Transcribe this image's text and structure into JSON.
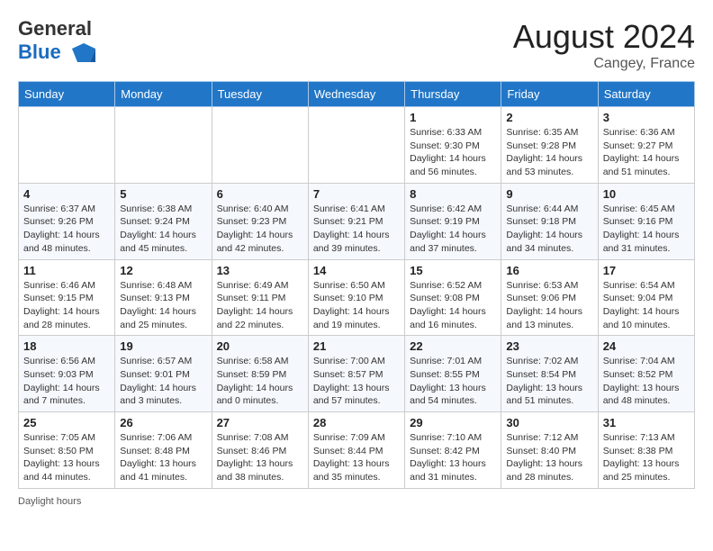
{
  "header": {
    "logo_line1": "General",
    "logo_line2": "Blue",
    "month": "August 2024",
    "location": "Cangey, France"
  },
  "days_of_week": [
    "Sunday",
    "Monday",
    "Tuesday",
    "Wednesday",
    "Thursday",
    "Friday",
    "Saturday"
  ],
  "weeks": [
    [
      {
        "day": "",
        "info": ""
      },
      {
        "day": "",
        "info": ""
      },
      {
        "day": "",
        "info": ""
      },
      {
        "day": "",
        "info": ""
      },
      {
        "day": "1",
        "info": "Sunrise: 6:33 AM\nSunset: 9:30 PM\nDaylight: 14 hours and 56 minutes."
      },
      {
        "day": "2",
        "info": "Sunrise: 6:35 AM\nSunset: 9:28 PM\nDaylight: 14 hours and 53 minutes."
      },
      {
        "day": "3",
        "info": "Sunrise: 6:36 AM\nSunset: 9:27 PM\nDaylight: 14 hours and 51 minutes."
      }
    ],
    [
      {
        "day": "4",
        "info": "Sunrise: 6:37 AM\nSunset: 9:26 PM\nDaylight: 14 hours and 48 minutes."
      },
      {
        "day": "5",
        "info": "Sunrise: 6:38 AM\nSunset: 9:24 PM\nDaylight: 14 hours and 45 minutes."
      },
      {
        "day": "6",
        "info": "Sunrise: 6:40 AM\nSunset: 9:23 PM\nDaylight: 14 hours and 42 minutes."
      },
      {
        "day": "7",
        "info": "Sunrise: 6:41 AM\nSunset: 9:21 PM\nDaylight: 14 hours and 39 minutes."
      },
      {
        "day": "8",
        "info": "Sunrise: 6:42 AM\nSunset: 9:19 PM\nDaylight: 14 hours and 37 minutes."
      },
      {
        "day": "9",
        "info": "Sunrise: 6:44 AM\nSunset: 9:18 PM\nDaylight: 14 hours and 34 minutes."
      },
      {
        "day": "10",
        "info": "Sunrise: 6:45 AM\nSunset: 9:16 PM\nDaylight: 14 hours and 31 minutes."
      }
    ],
    [
      {
        "day": "11",
        "info": "Sunrise: 6:46 AM\nSunset: 9:15 PM\nDaylight: 14 hours and 28 minutes."
      },
      {
        "day": "12",
        "info": "Sunrise: 6:48 AM\nSunset: 9:13 PM\nDaylight: 14 hours and 25 minutes."
      },
      {
        "day": "13",
        "info": "Sunrise: 6:49 AM\nSunset: 9:11 PM\nDaylight: 14 hours and 22 minutes."
      },
      {
        "day": "14",
        "info": "Sunrise: 6:50 AM\nSunset: 9:10 PM\nDaylight: 14 hours and 19 minutes."
      },
      {
        "day": "15",
        "info": "Sunrise: 6:52 AM\nSunset: 9:08 PM\nDaylight: 14 hours and 16 minutes."
      },
      {
        "day": "16",
        "info": "Sunrise: 6:53 AM\nSunset: 9:06 PM\nDaylight: 14 hours and 13 minutes."
      },
      {
        "day": "17",
        "info": "Sunrise: 6:54 AM\nSunset: 9:04 PM\nDaylight: 14 hours and 10 minutes."
      }
    ],
    [
      {
        "day": "18",
        "info": "Sunrise: 6:56 AM\nSunset: 9:03 PM\nDaylight: 14 hours and 7 minutes."
      },
      {
        "day": "19",
        "info": "Sunrise: 6:57 AM\nSunset: 9:01 PM\nDaylight: 14 hours and 3 minutes."
      },
      {
        "day": "20",
        "info": "Sunrise: 6:58 AM\nSunset: 8:59 PM\nDaylight: 14 hours and 0 minutes."
      },
      {
        "day": "21",
        "info": "Sunrise: 7:00 AM\nSunset: 8:57 PM\nDaylight: 13 hours and 57 minutes."
      },
      {
        "day": "22",
        "info": "Sunrise: 7:01 AM\nSunset: 8:55 PM\nDaylight: 13 hours and 54 minutes."
      },
      {
        "day": "23",
        "info": "Sunrise: 7:02 AM\nSunset: 8:54 PM\nDaylight: 13 hours and 51 minutes."
      },
      {
        "day": "24",
        "info": "Sunrise: 7:04 AM\nSunset: 8:52 PM\nDaylight: 13 hours and 48 minutes."
      }
    ],
    [
      {
        "day": "25",
        "info": "Sunrise: 7:05 AM\nSunset: 8:50 PM\nDaylight: 13 hours and 44 minutes."
      },
      {
        "day": "26",
        "info": "Sunrise: 7:06 AM\nSunset: 8:48 PM\nDaylight: 13 hours and 41 minutes."
      },
      {
        "day": "27",
        "info": "Sunrise: 7:08 AM\nSunset: 8:46 PM\nDaylight: 13 hours and 38 minutes."
      },
      {
        "day": "28",
        "info": "Sunrise: 7:09 AM\nSunset: 8:44 PM\nDaylight: 13 hours and 35 minutes."
      },
      {
        "day": "29",
        "info": "Sunrise: 7:10 AM\nSunset: 8:42 PM\nDaylight: 13 hours and 31 minutes."
      },
      {
        "day": "30",
        "info": "Sunrise: 7:12 AM\nSunset: 8:40 PM\nDaylight: 13 hours and 28 minutes."
      },
      {
        "day": "31",
        "info": "Sunrise: 7:13 AM\nSunset: 8:38 PM\nDaylight: 13 hours and 25 minutes."
      }
    ]
  ],
  "footer": {
    "note": "Daylight hours"
  }
}
